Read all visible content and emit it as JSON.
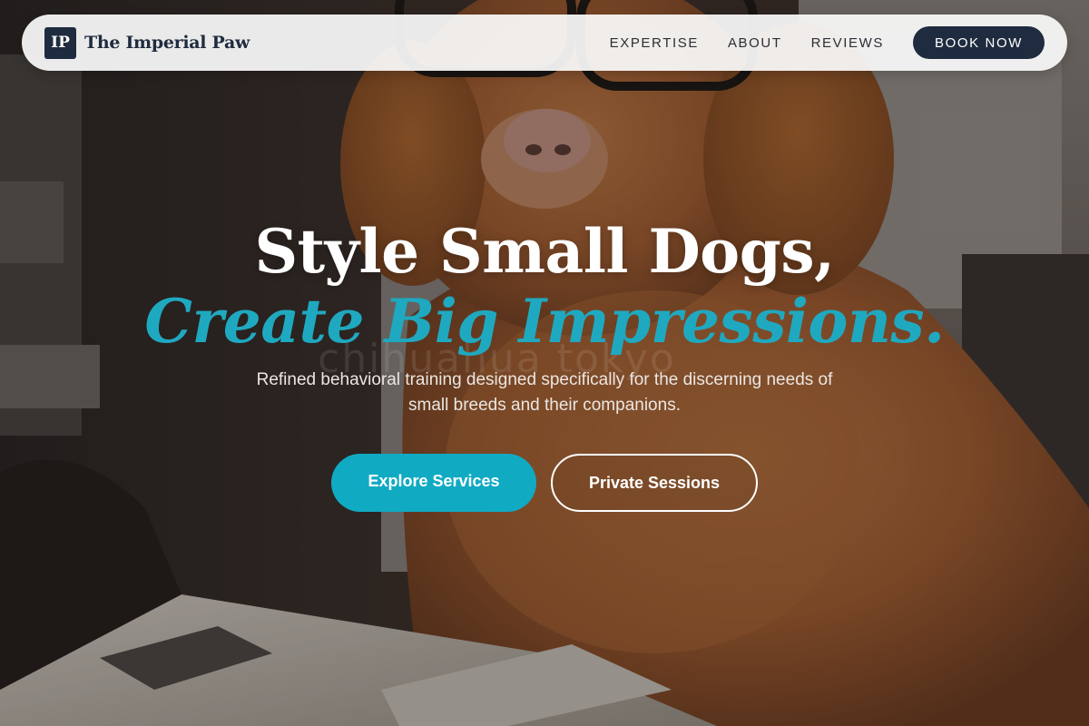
{
  "brand": {
    "mark": "IP",
    "name": "The Imperial Paw"
  },
  "nav": {
    "links": [
      {
        "label": "EXPERTISE"
      },
      {
        "label": "ABOUT"
      },
      {
        "label": "REVIEWS"
      }
    ],
    "cta_label": "BOOK NOW"
  },
  "hero": {
    "title_line_1": "Style Small Dogs,",
    "title_line_2": "Create Big Impressions.",
    "subtitle": "Refined behavioral training designed specifically for the discerning needs of small breeds and their companions.",
    "watermark": "chihuahua tokyo",
    "primary_cta": "Explore Services",
    "secondary_cta": "Private Sessions",
    "background_image": "dog-with-glasses-photo"
  },
  "colors": {
    "navy": "#1f2b3e",
    "accent_teal": "#10aac3",
    "headline_teal": "#1fa9c0",
    "navbar_bg": "#fafafa"
  }
}
